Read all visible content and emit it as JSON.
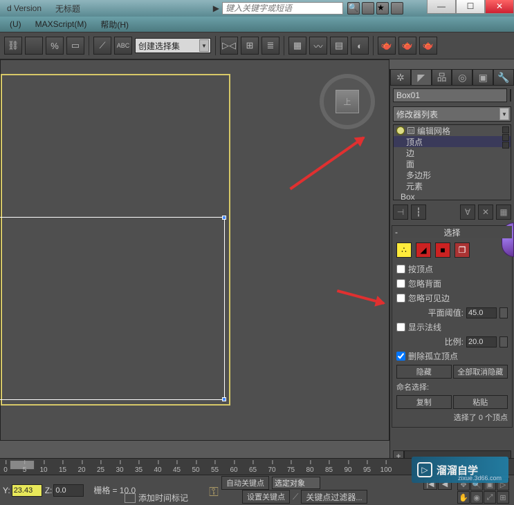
{
  "title": {
    "version": "d Version",
    "untitled": "无标题"
  },
  "search": {
    "placeholder": "键入关键字或短语"
  },
  "menus": {
    "u": "(U)",
    "maxscript": "MAXScript(M)",
    "help": "帮助(H)"
  },
  "toolbar": {
    "selection_set": "创建选择集"
  },
  "viewcube": {
    "face": "上"
  },
  "object": {
    "name": "Box01"
  },
  "modifier": {
    "list_label": "修改器列表",
    "stack": {
      "edit_mesh": "编辑网格",
      "vertex": "顶点",
      "edge": "边",
      "face": "面",
      "polygon": "多边形",
      "element": "元素",
      "base": "Box"
    }
  },
  "selection": {
    "header": "选择",
    "by_vertex": "按顶点",
    "ignore_backfacing": "忽略背面",
    "ignore_visible_edges": "忽略可见边",
    "planar_thresh_label": "平面阈值:",
    "planar_thresh": "45.0",
    "show_normals": "显示法线",
    "scale_label": "比例:",
    "scale": "20.0",
    "delete_isolated": "删除孤立顶点",
    "hide": "隐藏",
    "unhide_all": "全部取消隐藏",
    "named_sel": "命名选择:",
    "copy": "复制",
    "paste": "粘贴",
    "status": "选择了 0 个顶点"
  },
  "timeline": {
    "ticks": [
      "0",
      "5",
      "10",
      "15",
      "20",
      "25",
      "30",
      "35",
      "40",
      "45",
      "50",
      "55",
      "60",
      "65",
      "70",
      "75",
      "80",
      "85",
      "90",
      "95",
      "100"
    ]
  },
  "status": {
    "y_label": "Y:",
    "y": "23.43",
    "z_label": "Z:",
    "z": "0.0",
    "grid_label": "栅格",
    "grid": "= 10.0",
    "auto_key": "自动关键点",
    "selected": "选定对象",
    "set_key": "设置关键点",
    "key_filters": "关键点过滤器",
    "add_time_tag": "添加时间标记"
  },
  "watermark": {
    "brand": "溜溜自学",
    "url": "zixue.3d66.com"
  }
}
